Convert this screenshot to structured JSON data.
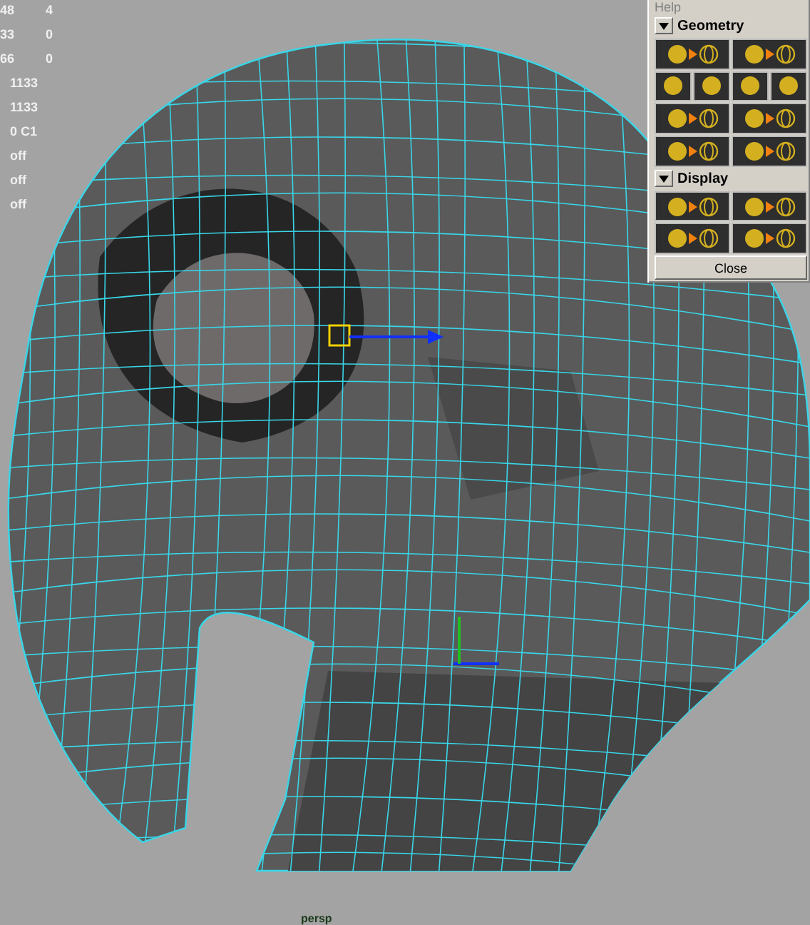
{
  "hud": [
    {
      "cells": [
        "48",
        "4"
      ]
    },
    {
      "cells": [
        "33",
        "0"
      ]
    },
    {
      "cells": [
        "66",
        "0"
      ]
    },
    {
      "cells": [
        "1133"
      ]
    },
    {
      "cells": [
        "1133"
      ]
    },
    {
      "cells": [
        "0 C1"
      ]
    },
    {
      "cells": [
        "off"
      ]
    },
    {
      "cells": [
        "off"
      ]
    },
    {
      "cells": [
        "off"
      ]
    }
  ],
  "panel": {
    "menu": "Help",
    "sections": [
      {
        "title": "Geometry",
        "expanded": true
      },
      {
        "title": "Display",
        "expanded": true
      }
    ],
    "close": "Close"
  },
  "camera": "persp"
}
